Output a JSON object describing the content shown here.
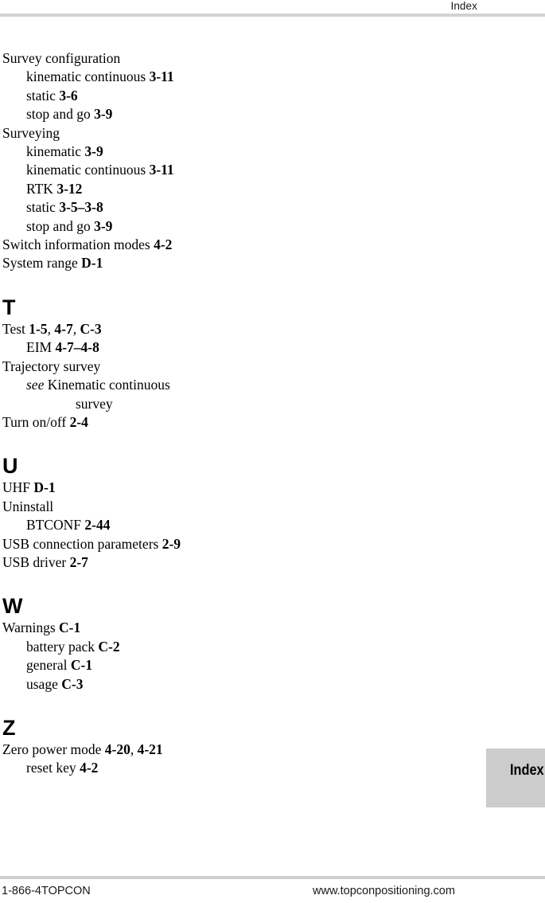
{
  "header": {
    "title": "Index"
  },
  "footer": {
    "phone": "1-866-4TOPCON",
    "url": "www.topconpositioning.com"
  },
  "side_tab": {
    "label": "Index",
    "background_color": "#cccccc"
  },
  "rules": {
    "header_rule_color": "#d2d2d2",
    "footer_rule_color": "#cfcfcf"
  },
  "index": {
    "sections": [
      {
        "letter": "",
        "entries": [
          {
            "level": "main",
            "text": "Survey configuration",
            "refs": ""
          },
          {
            "level": "sub",
            "text": "kinematic continuous",
            "refs": "3-11"
          },
          {
            "level": "sub",
            "text": "static",
            "refs": "3-6"
          },
          {
            "level": "sub",
            "text": "stop and go",
            "refs": "3-9"
          },
          {
            "level": "main",
            "text": "Surveying",
            "refs": ""
          },
          {
            "level": "sub",
            "text": "kinematic",
            "refs": "3-9"
          },
          {
            "level": "sub",
            "text": "kinematic continuous",
            "refs": "3-11"
          },
          {
            "level": "sub",
            "text": "RTK",
            "refs": "3-12"
          },
          {
            "level": "sub",
            "text": "static",
            "refs": "3-5–3-8"
          },
          {
            "level": "sub",
            "text": "stop and go",
            "refs": "3-9"
          },
          {
            "level": "main",
            "text": "Switch information modes",
            "refs": "4-2"
          },
          {
            "level": "main",
            "text": "System range",
            "refs": "D-1"
          }
        ]
      },
      {
        "letter": "T",
        "entries": [
          {
            "level": "main",
            "text": "Test",
            "refs": "1-5, 4-7, C-3"
          },
          {
            "level": "sub",
            "text": "EIM",
            "refs": "4-7–4-8"
          },
          {
            "level": "main",
            "text": "Trajectory survey",
            "refs": ""
          },
          {
            "level": "sub",
            "text": "see Kinematic continuous",
            "refs": "",
            "see": true
          },
          {
            "level": "subwrap",
            "text": "survey",
            "refs": ""
          },
          {
            "level": "main",
            "text": "Turn on/off",
            "refs": "2-4"
          }
        ]
      },
      {
        "letter": "U",
        "entries": [
          {
            "level": "main",
            "text": "UHF",
            "refs": "D-1"
          },
          {
            "level": "main",
            "text": "Uninstall",
            "refs": ""
          },
          {
            "level": "sub",
            "text": "BTCONF",
            "refs": "2-44"
          },
          {
            "level": "main",
            "text": "USB connection parameters",
            "refs": "2-9"
          },
          {
            "level": "main",
            "text": "USB driver",
            "refs": "2-7"
          }
        ]
      },
      {
        "letter": "W",
        "entries": [
          {
            "level": "main",
            "text": "Warnings",
            "refs": "C-1"
          },
          {
            "level": "sub",
            "text": "battery pack",
            "refs": "C-2"
          },
          {
            "level": "sub",
            "text": "general",
            "refs": "C-1"
          },
          {
            "level": "sub",
            "text": "usage",
            "refs": "C-3"
          }
        ]
      },
      {
        "letter": "Z",
        "entries": [
          {
            "level": "main",
            "text": "Zero power mode",
            "refs": "4-20, 4-21"
          },
          {
            "level": "sub",
            "text": "reset key",
            "refs": "4-2"
          }
        ]
      }
    ]
  }
}
